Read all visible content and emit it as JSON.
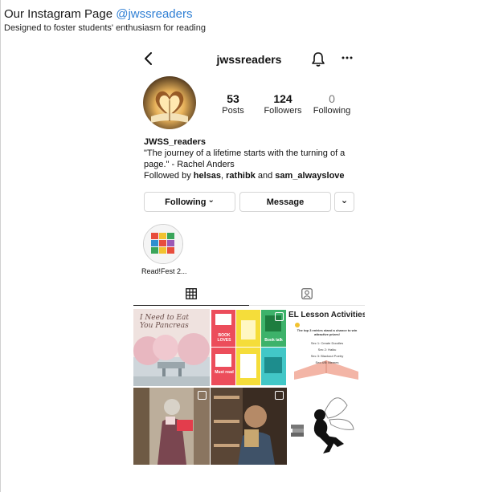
{
  "page": {
    "title_prefix": "Our Instagram Page ",
    "title_handle": "@jwssreaders",
    "subtitle": "Designed to foster students' enthusiasm for reading"
  },
  "profile": {
    "username": "jwssreaders",
    "display_name": "JWSS_readers",
    "bio_line1": "\"The journey of a lifetime starts with the turning of a",
    "bio_line2": "page.\" - Rachel Anders",
    "followed_prefix": "Followed by ",
    "followed_user1": "helsas",
    "followed_sep": ", ",
    "followed_user2": "rathibk",
    "followed_and": " and ",
    "followed_user3": "sam_alwayslove"
  },
  "stats": [
    {
      "value": "53",
      "label": "Posts"
    },
    {
      "value": "124",
      "label": "Followers"
    },
    {
      "value": "0",
      "label": "Following"
    }
  ],
  "buttons": {
    "following": "Following",
    "following_caret": "⌄",
    "message": "Message",
    "more": "⌄"
  },
  "highlight": {
    "label": "Read!Fest 2..."
  },
  "posts": [
    {
      "text": "I Need to Eat You Pancreas"
    },
    {
      "text": "BOOK LOVES",
      "text2": "Must read",
      "text3": "Book talk"
    },
    {
      "text": "EL Lesson Activities",
      "text2": "The top 3 entries stand a chance to win attractive prizes!",
      "text3": "Sec 1: Create Doodles",
      "text4": "Sec 2: Haiku",
      "text5": "Sec 3: Blackout Poetry",
      "text6": "Sec 4/5: Memes"
    },
    {},
    {},
    {}
  ],
  "icons": {
    "back": "back-arrow-icon",
    "bell": "bell-icon",
    "more": "ellipsis-icon",
    "grid": "grid-icon",
    "tagged": "tagged-person-icon",
    "multiple": "multiple-images-icon"
  },
  "colors": {
    "handle": "#2f7fd4",
    "accent_red": "#e53e3e"
  }
}
